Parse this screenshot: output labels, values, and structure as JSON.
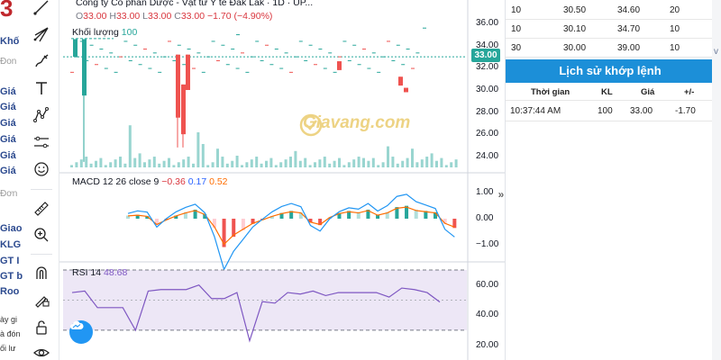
{
  "left_fragments": {
    "big_char": "3",
    "items": [
      {
        "text": "Khố",
        "style": "bold"
      },
      {
        "text": "Đon",
        "style": "grey"
      },
      {
        "text": "Giá",
        "style": "bold"
      },
      {
        "text": "Giá",
        "style": "bold"
      },
      {
        "text": "Giá",
        "style": "bold"
      },
      {
        "text": "Giá",
        "style": "bold"
      },
      {
        "text": "Giá",
        "style": "bold"
      },
      {
        "text": "Giá",
        "style": "bold"
      },
      {
        "text": "Đơn",
        "style": "grey"
      },
      {
        "text": "Giao",
        "style": "bold"
      },
      {
        "text": "KLG",
        "style": "bold"
      },
      {
        "text": "GT I",
        "style": "bold"
      },
      {
        "text": "GT b",
        "style": "bold"
      },
      {
        "text": "Roo",
        "style": "bold"
      },
      {
        "text": "ày gi",
        "style": "plain"
      },
      {
        "text": "à đón",
        "style": "plain"
      },
      {
        "text": "ối lư",
        "style": "plain"
      }
    ]
  },
  "toolbar": {
    "tools": [
      "line-tool-icon",
      "fork-tool-icon",
      "brush-tool-icon",
      "text-tool-icon",
      "pattern-tool-icon",
      "measure-tool-icon",
      "emoji-icon",
      "ruler-icon",
      "zoom-in-icon",
      "magnet-icon",
      "lock-draw-icon",
      "lock-icon",
      "eye-icon"
    ]
  },
  "chart": {
    "title": "Công ty Cổ phần Dược - Vật tư Y tế Đắk Lắk · 1D · UP...",
    "ohlc": {
      "o_label": "O",
      "o": "33.00",
      "h_label": "H",
      "h": "33.00",
      "l_label": "L",
      "l": "33.00",
      "c_label": "C",
      "c": "33.00",
      "change": "−1.70 (−4.90%)"
    },
    "volume_label": "Khối lượng",
    "volume_value": "100",
    "macd_label": "MACD 12 26 close 9",
    "macd_hist": "−0.36",
    "macd_line": "0.17",
    "macd_signal": "0.52",
    "rsi_label": "RSI 14",
    "rsi_value": "48.68",
    "last_price_tag": "33.00",
    "watermark": "Giavang.com",
    "colors": {
      "up": "#26a69a",
      "down": "#ef5350",
      "macd": "#2196f3",
      "signal": "#ff6d00",
      "rsi": "#7e57c2",
      "rsi_bg": "#ede7f6"
    }
  },
  "chart_data": [
    {
      "type": "bar",
      "title": "",
      "ylim": [
        23,
        37
      ],
      "y_ticks": [
        "36.00",
        "34.00",
        "32.00",
        "30.00",
        "28.00",
        "26.00",
        "24.00"
      ],
      "note": "price candles (red long candles down)",
      "series": [
        {
          "values": [
            32.5,
            33.2,
            34.4,
            30.0,
            32.6,
            30.7,
            33.6,
            33.0,
            33.3,
            32.0,
            33.0,
            32.5,
            33.9,
            33.8,
            33.6,
            32.6,
            33.0,
            32.6,
            33.0,
            31.6,
            34.1,
            33.8,
            33.0
          ]
        }
      ]
    },
    {
      "type": "bar",
      "title": "",
      "ylim": [
        -1.5,
        1.5
      ],
      "y_ticks": [
        "1.00",
        "0.00",
        "−1.00"
      ],
      "series": [
        {
          "values": [
            0.12,
            0.15,
            0.1,
            -0.25,
            -0.05,
            0.12,
            0.25,
            0.35,
            0.18,
            -0.35,
            -1.1,
            -0.7,
            -0.45,
            -0.2,
            -0.05,
            0.1,
            0.22,
            0.3,
            0.25,
            -0.15,
            -0.25,
            0.05,
            0.22,
            0.3,
            0.25,
            0.35,
            0.15,
            0.25,
            0.45,
            0.5,
            0.35,
            0.3,
            0.25,
            -0.2,
            -0.36
          ]
        }
      ]
    },
    {
      "type": "line",
      "title": "",
      "ylim": [
        15,
        70
      ],
      "y_ticks": [
        "60.00",
        "40.00",
        "20.00"
      ],
      "series": [
        {
          "values": [
            55,
            56,
            45,
            45,
            45,
            30,
            56,
            57,
            57,
            57,
            60,
            51,
            51,
            55,
            23,
            49,
            48,
            55,
            54,
            56,
            53,
            55,
            55,
            55,
            55,
            52,
            58,
            57,
            55,
            48.68
          ]
        }
      ]
    }
  ],
  "order_book": {
    "rows": [
      {
        "c1": "10",
        "c2": "30.50",
        "c3": "34.60",
        "c4": "20"
      },
      {
        "c1": "10",
        "c2": "30.10",
        "c3": "34.70",
        "c4": "10"
      },
      {
        "c1": "30",
        "c2": "30.00",
        "c3": "39.00",
        "c4": "10"
      }
    ]
  },
  "match_history": {
    "title": "Lịch sử khớp lệnh",
    "headers": {
      "time": "Thời gian",
      "kl": "KL",
      "price": "Giá",
      "change": "+/-"
    },
    "rows": [
      {
        "time": "10:37:44 AM",
        "kl": "100",
        "price": "33.00",
        "change": "-1.70"
      }
    ]
  },
  "right_edge": {
    "text": "v"
  }
}
